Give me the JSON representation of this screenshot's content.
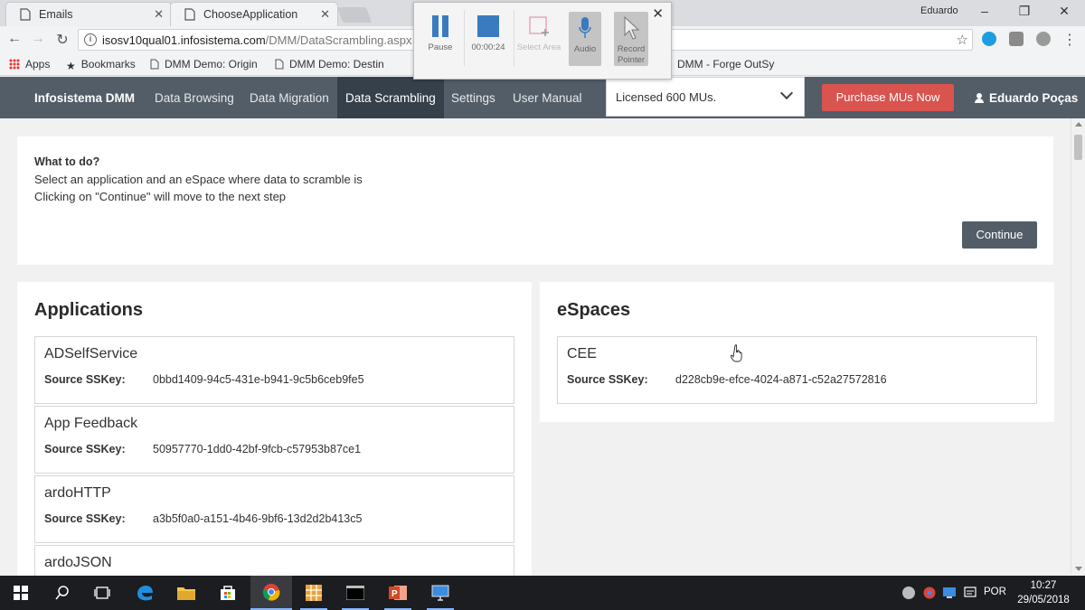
{
  "browser": {
    "tabs": [
      {
        "title": "Emails",
        "icon": "document-icon"
      },
      {
        "title": "ChooseApplication",
        "icon": "document-icon"
      }
    ],
    "profile_name": "Eduardo",
    "url_host": "isosv10qual01.infosistema.com",
    "url_path": "/DMM/DataScrambling.aspx",
    "bookmarks": [
      {
        "label": "Apps"
      },
      {
        "label": "Bookmarks"
      },
      {
        "label": "DMM Demo: Origin"
      },
      {
        "label": "DMM Demo: Destin"
      },
      {
        "label": "DMM - Forge OutSy"
      }
    ]
  },
  "recorder": {
    "pause_label": "Pause",
    "timer": "00:00:24",
    "select_area_label": "Select Area",
    "audio_label": "Audio",
    "record_pointer_label": "Record Pointer"
  },
  "nav": {
    "brand": "Infosistema DMM",
    "links": [
      "Data Browsing",
      "Data Migration",
      "Data Scrambling",
      "Settings",
      "User Manual"
    ],
    "active": "Data Scrambling",
    "license_select": "Licensed 600 MUs.",
    "purchase_button": "Purchase MUs Now",
    "user": "Eduardo Poças"
  },
  "instructions": {
    "heading": "What to do?",
    "line1": "Select an application and an eSpace where data to scramble is",
    "line2": "Clicking on \"Continue\" will move to the next step",
    "continue_button": "Continue"
  },
  "applications": {
    "title": "Applications",
    "key_label": "Source SSKey:",
    "items": [
      {
        "name": "ADSelfService",
        "key": "0bbd1409-94c5-431e-b941-9c5b6ceb9fe5"
      },
      {
        "name": "App Feedback",
        "key": "50957770-1dd0-42bf-9fcb-c57953b87ce1"
      },
      {
        "name": "ardoHTTP",
        "key": "a3b5f0a0-a151-4b46-9bf6-13d2d2b413c5"
      },
      {
        "name": "ardoJSON",
        "key": ""
      }
    ]
  },
  "espaces": {
    "title": "eSpaces",
    "key_label": "Source SSKey:",
    "items": [
      {
        "name": "CEE",
        "key": "d228cb9e-efce-4024-a871-c52a27572816"
      }
    ]
  },
  "taskbar": {
    "language": "POR",
    "time": "10:27",
    "date": "29/05/2018"
  },
  "colors": {
    "nav_bg": "#525d68",
    "nav_active_bg": "#36404b",
    "purchase_red": "#d9534f",
    "continue_bg": "#525d68",
    "page_bg": "#f1f1f1"
  }
}
